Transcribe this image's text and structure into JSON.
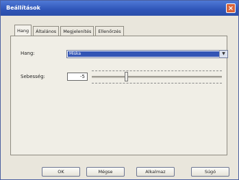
{
  "window": {
    "title": "Beállítások",
    "close_icon": "×"
  },
  "tabs": [
    {
      "label": "Hang",
      "active": true
    },
    {
      "label": "Általános",
      "active": false
    },
    {
      "label": "Megjelenítés",
      "active": false
    },
    {
      "label": "Ellenőrzés",
      "active": false
    }
  ],
  "voice": {
    "label": "Hang:",
    "value": "Miska",
    "arrow_icon": "chevron-down-icon"
  },
  "speed": {
    "label": "Sebesség:",
    "value": "-5",
    "slider_fraction": 0.25
  },
  "buttons": {
    "ok": "OK",
    "cancel": "Mégse",
    "apply": "Alkalmaz",
    "help": "Súgó"
  }
}
